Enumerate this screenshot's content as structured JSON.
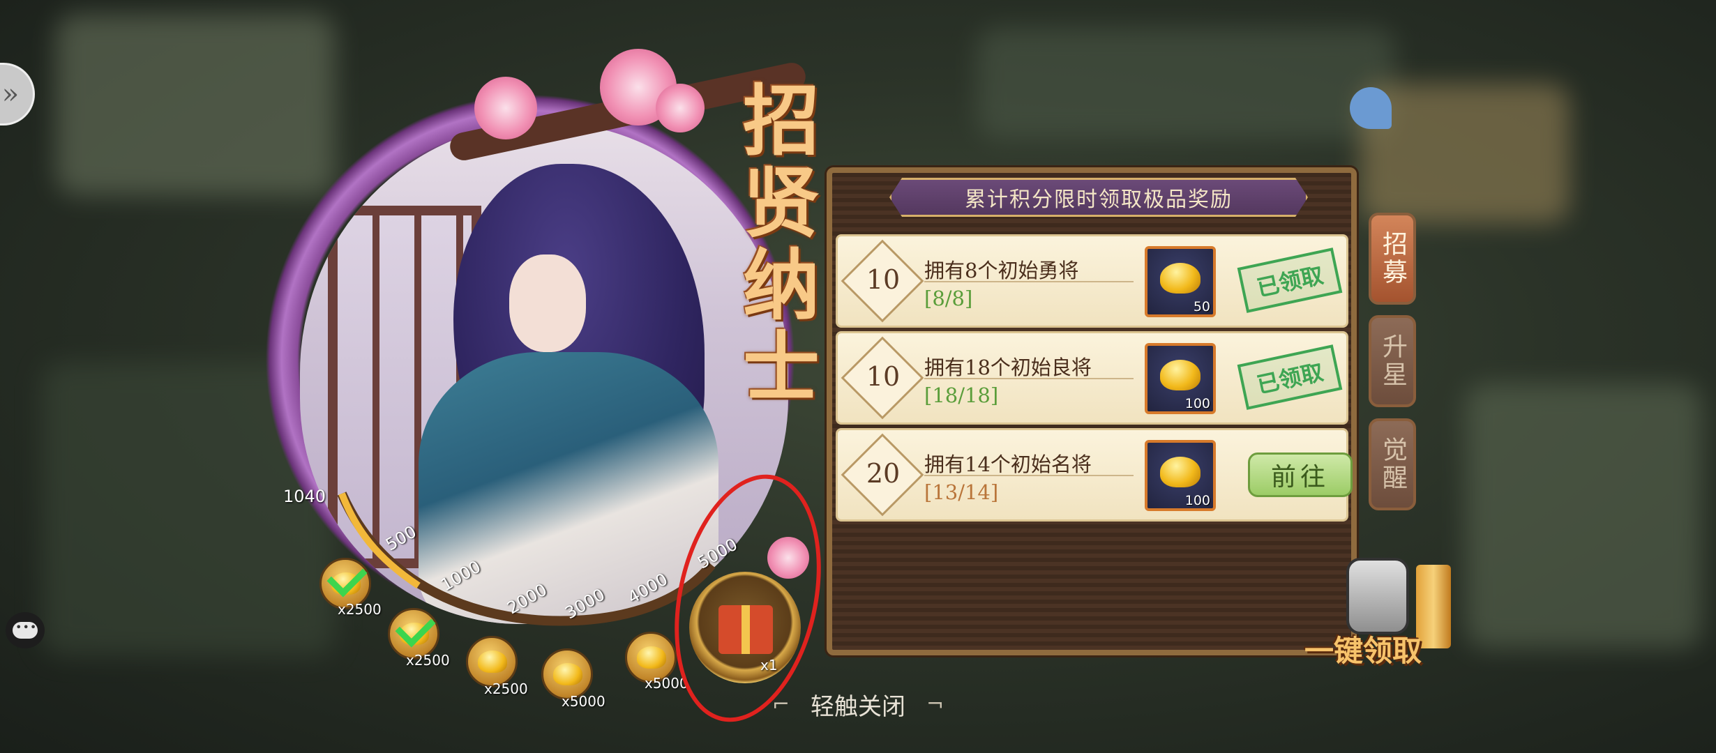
{
  "title_chars": [
    "招",
    "贤",
    "纳",
    "士"
  ],
  "banner": "累计积分限时领取极品奖励",
  "tasks": [
    {
      "points": "10",
      "desc": "拥有8个初始勇将",
      "progress": "[8/8]",
      "reward_qty": "50",
      "state": "已领取",
      "progress_color": "#5a9d3a"
    },
    {
      "points": "10",
      "desc": "拥有18个初始良将",
      "progress": "[18/18]",
      "reward_qty": "100",
      "state": "已领取",
      "progress_color": "#5a9d3a"
    },
    {
      "points": "20",
      "desc": "拥有14个初始名将",
      "progress": "[13/14]",
      "reward_qty": "100",
      "state": "前往",
      "progress_color": "#b9753a"
    }
  ],
  "side_tabs": [
    {
      "label": "招募",
      "active": true
    },
    {
      "label": "升星",
      "active": false
    },
    {
      "label": "觉醒",
      "active": false
    }
  ],
  "score_current": "1040",
  "milestones": [
    "500",
    "1000",
    "2000",
    "3000",
    "4000",
    "5000"
  ],
  "milestone_rewards": [
    {
      "qty": "x2500",
      "claimed": true
    },
    {
      "qty": "x2500",
      "claimed": true
    },
    {
      "qty": "x2500",
      "claimed": false
    },
    {
      "qty": "x5000",
      "claimed": false
    },
    {
      "qty": "x5000",
      "claimed": false
    },
    {
      "qty": "x1",
      "claimed": false
    }
  ],
  "close_hint": "轻触关闭",
  "claim_all": "一键领取"
}
